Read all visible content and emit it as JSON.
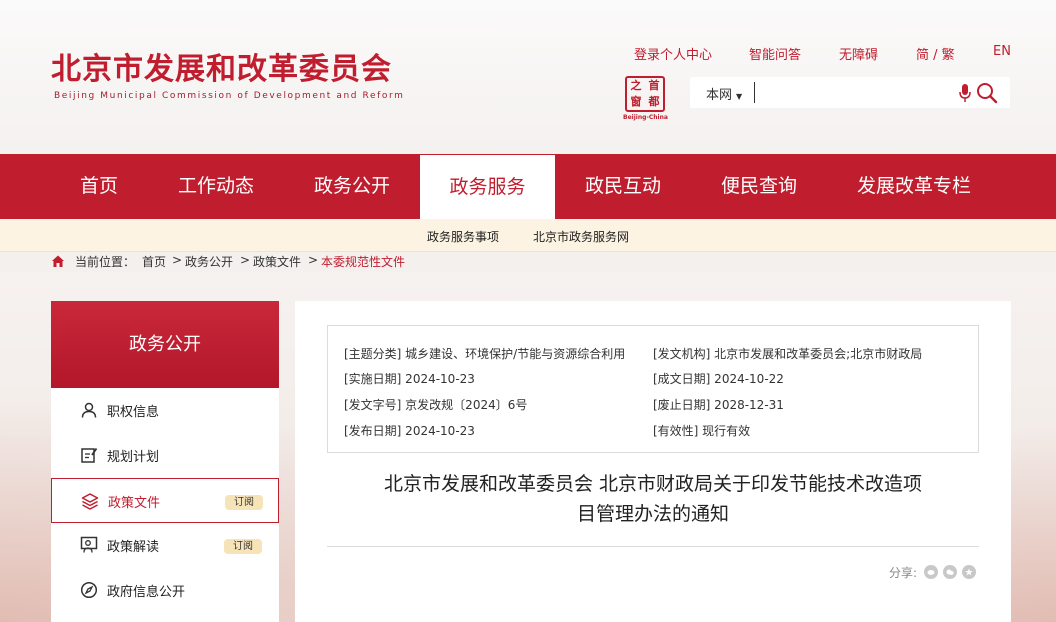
{
  "header": {
    "logo_cn": "北京市发展和改革委员会",
    "logo_en": "Beijing Municipal Commission of Development and Reform",
    "toplinks": [
      "登录个人中心",
      "智能问答",
      "无障碍",
      "简 / 繁",
      "EN"
    ],
    "seal": {
      "chars": [
        "首",
        "之",
        "都",
        "窗"
      ],
      "sub": "Beijing-China"
    },
    "search": {
      "scope": "本网",
      "placeholder": ""
    }
  },
  "nav": {
    "items": [
      "首页",
      "工作动态",
      "政务公开",
      "政务服务",
      "政民互动",
      "便民查询",
      "发展改革专栏"
    ],
    "active_index": 3,
    "sub_items": [
      "政务服务事项",
      "北京市政务服务网"
    ]
  },
  "breadcrumb": {
    "label": "当前位置：",
    "items": [
      "首页",
      "政务公开",
      "政策文件",
      "本委规范性文件"
    ],
    "sep": ">"
  },
  "sidebar": {
    "title": "政务公开",
    "items": [
      {
        "label": "职权信息",
        "icon": "person-icon",
        "badge": ""
      },
      {
        "label": "规划计划",
        "icon": "edit-doc-icon",
        "badge": ""
      },
      {
        "label": "政策文件",
        "icon": "layers-icon",
        "badge": "订阅"
      },
      {
        "label": "政策解读",
        "icon": "chat-person-icon",
        "badge": "订阅"
      },
      {
        "label": "政府信息公开",
        "icon": "compass-icon",
        "badge": ""
      }
    ],
    "active_index": 2
  },
  "document": {
    "meta": {
      "topic": "[主题分类] 城乡建设、环境保护/节能与资源综合利用",
      "issuer": "[发文机构] 北京市发展和改革委员会;北京市财政局",
      "effective_date": "[实施日期] 2024-10-23",
      "created_date": "[成文日期] 2024-10-22",
      "doc_number": "[发文字号] 京发改规〔2024〕6号",
      "expiry_date": "[废止日期] 2028-12-31",
      "publish_date": "[发布日期] 2024-10-23",
      "validity": "[有效性] 现行有效"
    },
    "title_line1": "北京市发展和改革委员会 北京市财政局关于印发节能技术改造项",
    "title_line2": "目管理办法的通知",
    "share_label": "分享:"
  },
  "colors": {
    "brand_red": "#c01d2e",
    "subnav_bg": "#fcf3e2",
    "badge_bg": "#f6e3b8"
  }
}
